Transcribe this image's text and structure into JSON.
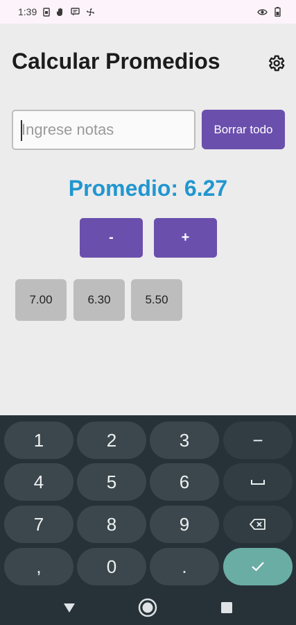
{
  "status_bar": {
    "time": "1:39",
    "icons": [
      "sim-icon",
      "hand-icon",
      "message-icon",
      "fan-icon"
    ],
    "right_icons": [
      "eye-icon",
      "battery-icon"
    ]
  },
  "app": {
    "title": "Calcular Promedios",
    "input_placeholder": "Ingrese notas",
    "clear_label": "Borrar todo",
    "average_label": "Promedio: 6.27",
    "minus_label": "-",
    "plus_label": "+",
    "grades": [
      "7.00",
      "6.30",
      "5.50"
    ]
  },
  "keyboard": {
    "rows": [
      [
        "1",
        "2",
        "3",
        "−"
      ],
      [
        "4",
        "5",
        "6",
        "␣"
      ],
      [
        "7",
        "8",
        "9",
        "⌫"
      ],
      [
        ",",
        "0",
        ".",
        "✓"
      ]
    ]
  },
  "colors": {
    "accent": "#6a4fad",
    "average": "#2196d0",
    "keyboard_bg": "#263238",
    "enter": "#6aada4"
  }
}
